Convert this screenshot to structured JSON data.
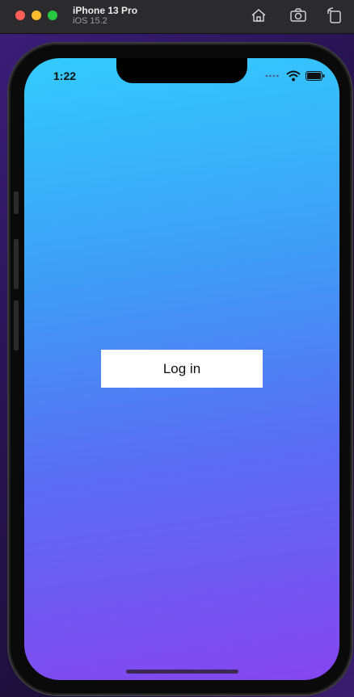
{
  "window": {
    "title": "iPhone 13 Pro",
    "subtitle": "iOS 15.2",
    "toolbar_icons": [
      "home-icon",
      "camera-icon",
      "rotate-icon"
    ]
  },
  "status_bar": {
    "time": "1:22",
    "icons": [
      "cellular-signal-icon",
      "wifi-icon",
      "battery-icon"
    ]
  },
  "screen": {
    "gradient_colors": [
      "#33cbfd",
      "#3f9cf6",
      "#5b6bf3",
      "#8546ef"
    ],
    "login_label": "Log in"
  },
  "colors": {
    "close": "#ff5f57",
    "minimize": "#febc2e",
    "zoom": "#28c840"
  }
}
